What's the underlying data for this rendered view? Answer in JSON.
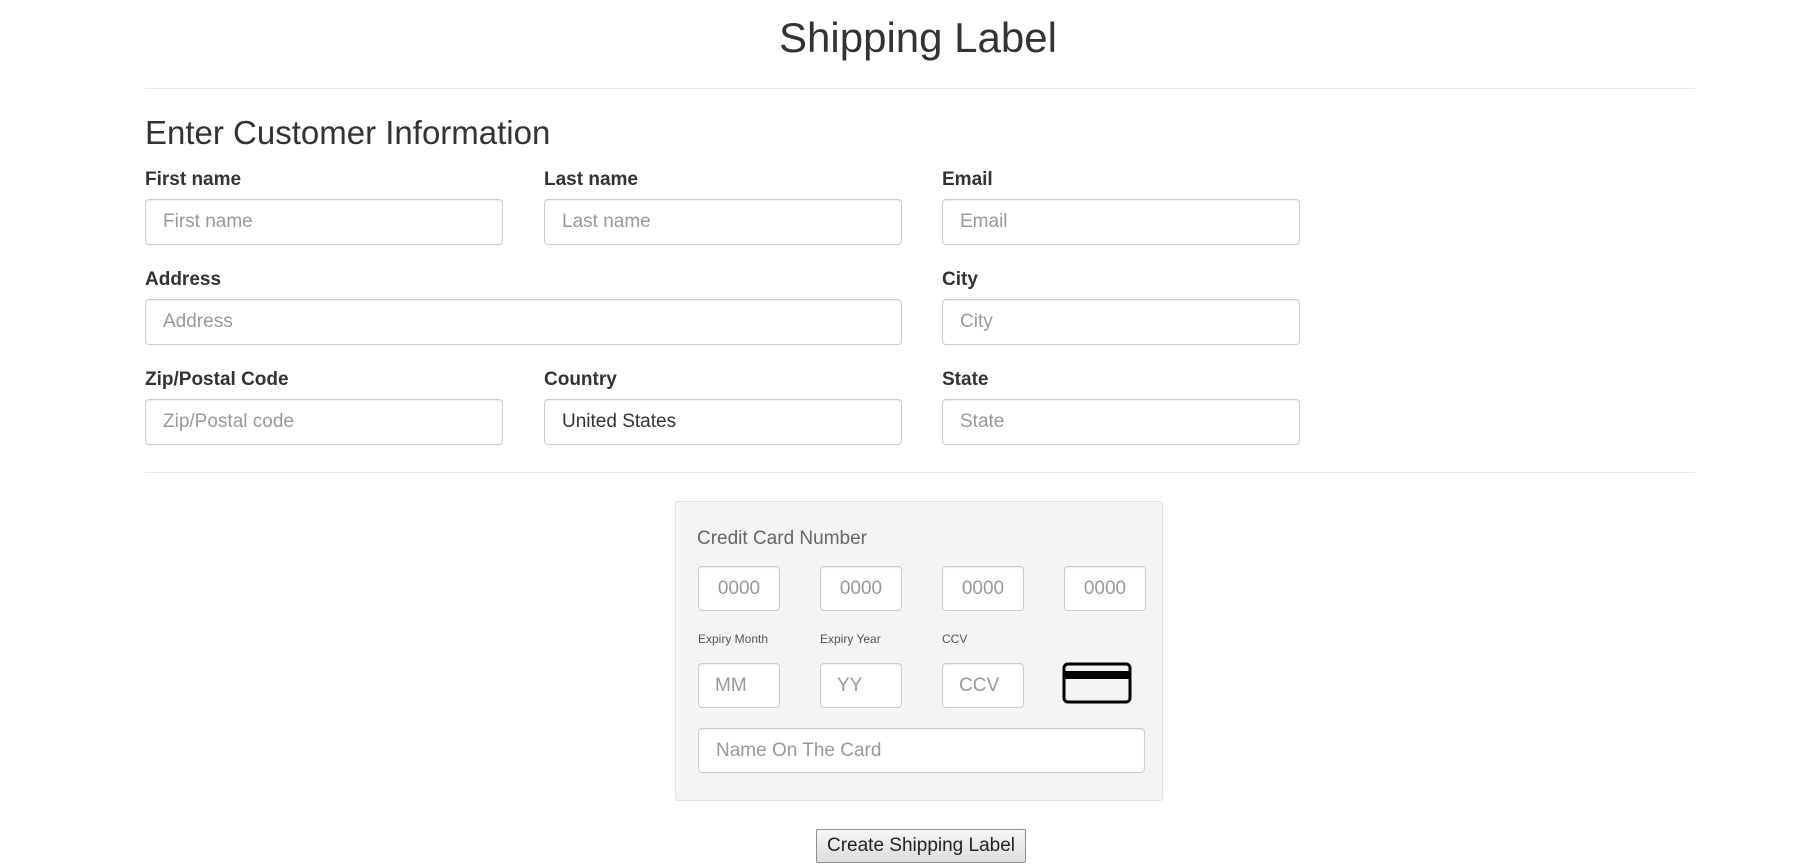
{
  "page": {
    "title": "Shipping Label"
  },
  "customer": {
    "section_title": "Enter Customer Information",
    "first_name": {
      "label": "First name",
      "placeholder": "First name",
      "value": ""
    },
    "last_name": {
      "label": "Last name",
      "placeholder": "Last name",
      "value": ""
    },
    "email": {
      "label": "Email",
      "placeholder": "Email",
      "value": ""
    },
    "address": {
      "label": "Address",
      "placeholder": "Address",
      "value": ""
    },
    "city": {
      "label": "City",
      "placeholder": "City",
      "value": ""
    },
    "zip": {
      "label": "Zip/Postal Code",
      "placeholder": "Zip/Postal code",
      "value": ""
    },
    "country": {
      "label": "Country",
      "value": "United States"
    },
    "state": {
      "label": "State",
      "placeholder": "State",
      "value": ""
    }
  },
  "credit_card": {
    "title": "Credit Card Number",
    "number_groups": [
      {
        "placeholder": "0000"
      },
      {
        "placeholder": "0000"
      },
      {
        "placeholder": "0000"
      },
      {
        "placeholder": "0000"
      }
    ],
    "expiry_month": {
      "label": "Expiry Month",
      "placeholder": "MM"
    },
    "expiry_year": {
      "label": "Expiry Year",
      "placeholder": "YY"
    },
    "ccv": {
      "label": "CCV",
      "placeholder": "CCV"
    },
    "name_on_card": {
      "placeholder": "Name On The Card"
    },
    "card_icon": "credit-card-icon"
  },
  "actions": {
    "submit_label": "Create Shipping Label"
  }
}
